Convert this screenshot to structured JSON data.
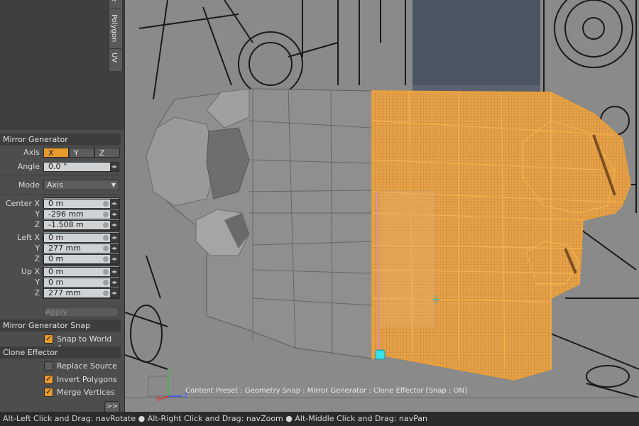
{
  "sidebar": {
    "tabs": [
      "e",
      "Polygon",
      "UV"
    ]
  },
  "mirror_generator": {
    "title": "Mirror Generator",
    "axis_label": "Axis",
    "axis_options": [
      "X",
      "Y",
      "Z"
    ],
    "axis_selected": "X",
    "angle_label": "Angle",
    "angle_value": "0.0 °",
    "mode_label": "Mode",
    "mode_value": "Axis",
    "center": {
      "label_x": "Center X",
      "label_y": "Y",
      "label_z": "Z",
      "x": "0 m",
      "y": "-296 mm",
      "z": "-1.508 m"
    },
    "left": {
      "label_x": "Left X",
      "label_y": "Y",
      "label_z": "Z",
      "x": "0 m",
      "y": "277 mm",
      "z": "0 m"
    },
    "up": {
      "label_x": "Up X",
      "label_y": "Y",
      "label_z": "Z",
      "x": "0 m",
      "y": "0 m",
      "z": "277 mm"
    },
    "apply_label": "Apply"
  },
  "mirror_generator_snap": {
    "title": "Mirror Generator Snap",
    "snap_to_world_label": "Snap to World A...",
    "snap_to_world_checked": true
  },
  "clone_effector": {
    "title": "Clone Effector",
    "replace_source_label": "Replace Source",
    "replace_source_checked": false,
    "invert_polygons_label": "Invert Polygons",
    "invert_polygons_checked": true,
    "merge_vertices_label": "Merge Vertices",
    "merge_vertices_checked": true,
    "expand_label": ">>"
  },
  "viewport": {
    "info_text": "Content Preset : Geometry Snap : Mirror Generator : Clone Effector  [Snap : ON]",
    "axis_gizmo": {
      "x": "X",
      "y": "Y",
      "z": "Z"
    }
  },
  "statusbar": {
    "text": "Alt-Left Click and Drag: navRotate ● Alt-Right Click and Drag: navZoom ● Alt-Middle Click and Drag: navPan"
  },
  "colors": {
    "panel": "#4d4d4d",
    "accent": "#e89a2c",
    "viewport_bg": "#848484",
    "selection": "#f0a033"
  }
}
